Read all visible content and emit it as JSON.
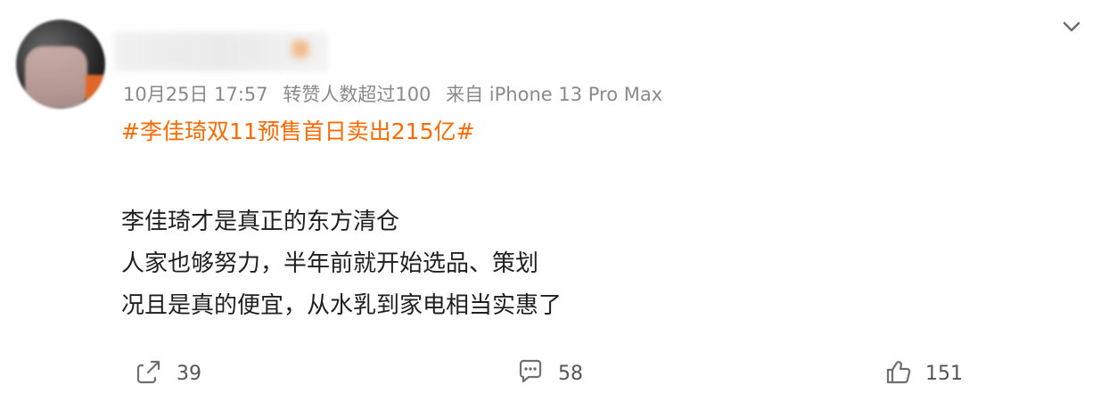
{
  "post": {
    "meta": {
      "time": "10月25日 17:57",
      "reposts_text": "转赞人数超过100",
      "source": "来自 iPhone 13 Pro Max"
    },
    "hashtag": "#李佳琦双11预售首日卖出215亿#",
    "content_lines": [
      "李佳琦才是真正的东方清仓",
      "人家也够努力，半年前就开始选品、策划",
      "况且是真的便宜，从水乳到家电相当实惠了"
    ],
    "actions": {
      "repost_count": "39",
      "comment_count": "58",
      "like_count": "151"
    }
  },
  "icons": {
    "menu": "chevron-down-icon",
    "repost": "share-icon",
    "comment": "comment-icon",
    "like": "thumbs-up-icon"
  },
  "colors": {
    "hashtag": "#ff6a00",
    "meta_text": "#8a8a8a",
    "body_text": "#1f1f1f",
    "icon_gray": "#6f6f6f"
  }
}
